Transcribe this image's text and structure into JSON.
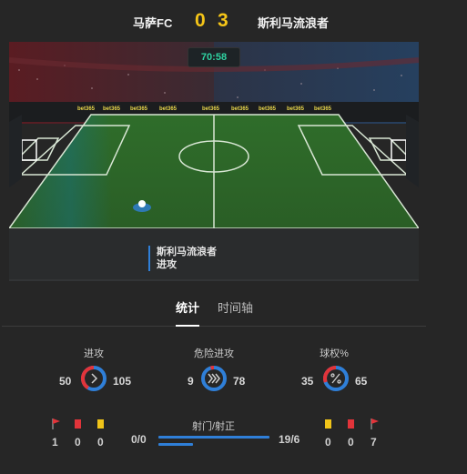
{
  "match": {
    "home_team": "马萨FC",
    "away_team": "斯利马流浪者",
    "home_score": "0",
    "away_score": "3",
    "clock": "70:58"
  },
  "event": {
    "team": "斯利马流浪者",
    "action": "进攻"
  },
  "tabs": [
    {
      "label": "统计",
      "active": true
    },
    {
      "label": "时间轴",
      "active": false
    }
  ],
  "stats": {
    "attacks": {
      "label": "进攻",
      "home": "50",
      "away": "105"
    },
    "dangerous_attacks": {
      "label": "危险进攻",
      "home": "9",
      "away": "78"
    },
    "possession": {
      "label": "球权%",
      "home": "35",
      "away": "65"
    }
  },
  "bottom": {
    "home_corners": "1",
    "home_red": "0",
    "home_yellow": "0",
    "shots_label": "射门/射正",
    "home_shots": "0/0",
    "away_shots": "19/6",
    "away_yellow": "0",
    "away_red": "0",
    "away_corners": "7"
  },
  "ad_text": "bet365",
  "colors": {
    "home": "#e2343a",
    "away": "#2f7fd8",
    "score": "#f5c518",
    "clock": "#2fd3a2"
  }
}
